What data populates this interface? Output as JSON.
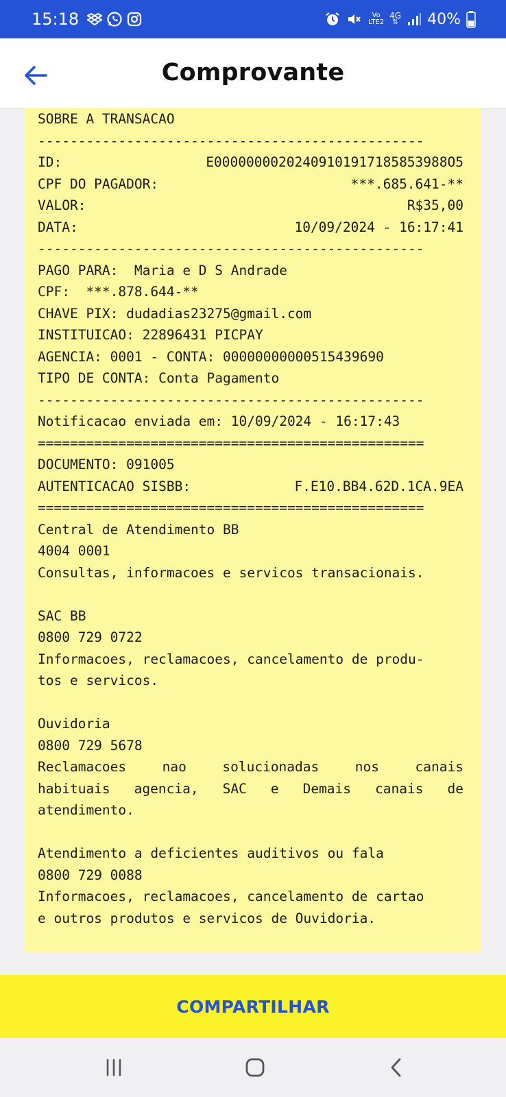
{
  "status_bar": {
    "time": "15:18",
    "network_top": "Vo",
    "network_bottom": "LTE2",
    "network_gen": "4G",
    "battery": "40%",
    "left_icons": [
      "dropbox-icon",
      "whatsapp-icon",
      "instagram-icon"
    ],
    "right_icons": [
      "alarm-icon",
      "mute-icon",
      "volte-icon",
      "signal-icon",
      "battery-icon"
    ]
  },
  "header": {
    "title": "Comprovante",
    "back_icon": "arrow-left-icon"
  },
  "receipt": {
    "section_title": "SOBRE A TRANSACAO",
    "separator_dash": "------------------------------------------------",
    "separator_equal": "================================================",
    "id_label": "ID:",
    "id_value": "E00000000202409101917185853988O5",
    "cpf_payer_label": "CPF DO PAGADOR:",
    "cpf_payer_value": "***.685.641-**",
    "valor_label": "VALOR:",
    "valor_value": "R$35,00",
    "data_label": "DATA:",
    "data_value": "10/09/2024 - 16:17:41",
    "pago_para": "PAGO PARA:  Maria e D S Andrade",
    "cpf": "CPF:  ***.878.644-**",
    "chave_pix": "CHAVE PIX: dudadias23275@gmail.com",
    "instituicao": "INSTITUICAO: 22896431 PICPAY",
    "agencia_conta": "AGENCIA: 0001 - CONTA: 00000000000515439690",
    "tipo_conta": "TIPO DE CONTA: Conta Pagamento",
    "notificacao": "Notificacao enviada em: 10/09/2024 - 16:17:43",
    "documento": "DOCUMENTO: 091005",
    "autenticacao_label": "AUTENTICACAO SISBB:",
    "autenticacao_value": "F.E10.BB4.62D.1CA.9EA",
    "central_title": "Central de Atendimento BB",
    "central_phone": "4004 0001",
    "central_desc": "Consultas, informacoes e servicos transacionais.",
    "sac_title": "SAC BB",
    "sac_phone": "0800 729 0722",
    "sac_desc_1": "Informacoes, reclamacoes, cancelamento de produ-",
    "sac_desc_2": "tos e servicos.",
    "ouvidoria_title": "Ouvidoria",
    "ouvidoria_phone": "0800 729 5678",
    "ouvidoria_desc_1": [
      "Reclamacoes",
      "nao",
      "solucionadas",
      "nos",
      "canais"
    ],
    "ouvidoria_desc_2": [
      "habituais",
      "agencia,",
      "SAC",
      "e",
      "Demais",
      "canais",
      "de"
    ],
    "ouvidoria_desc_3": "atendimento.",
    "deficientes_title": "Atendimento a deficientes auditivos ou fala",
    "deficientes_phone": "0800 729 0088",
    "deficientes_desc_1": "Informacoes, reclamacoes, cancelamento de cartao",
    "deficientes_desc_2": "e outros produtos e servicos de Ouvidoria."
  },
  "share_button": {
    "label": "COMPARTILHAR"
  },
  "nav_bar": {
    "icons": [
      "recent-apps-icon",
      "home-icon",
      "back-icon"
    ]
  },
  "colors": {
    "brand_blue": "#2453d6",
    "receipt_yellow": "#fdf9a0",
    "share_yellow": "#fbf22a"
  }
}
